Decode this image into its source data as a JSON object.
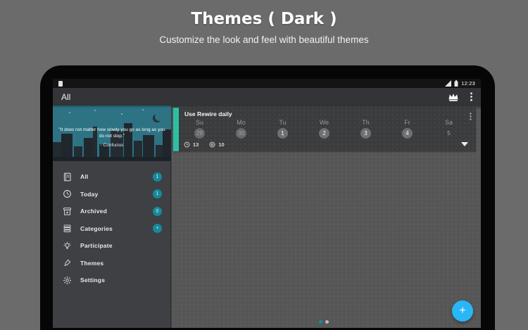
{
  "header": {
    "title": "Themes ( Dark )",
    "subtitle": "Customize the look and feel with beautiful themes"
  },
  "statusbar": {
    "time": "12:23"
  },
  "appbar": {
    "title": "All"
  },
  "drawer": {
    "quote_text": "\"It does not matter how slowly you go as long as you do not stop.\"",
    "quote_author": "- Confucius",
    "items": [
      {
        "label": "All",
        "badge": "1",
        "icon": "journal-icon"
      },
      {
        "label": "Today",
        "badge": "1",
        "icon": "today-icon"
      },
      {
        "label": "Archived",
        "badge": "0",
        "icon": "archive-icon"
      },
      {
        "label": "Categories",
        "badge": "+",
        "icon": "categories-icon"
      },
      {
        "label": "Participate",
        "badge": "",
        "icon": "lightbulb-icon"
      },
      {
        "label": "Themes",
        "badge": "",
        "icon": "paintbrush-icon"
      },
      {
        "label": "Settings",
        "badge": "",
        "icon": "gear-icon"
      }
    ]
  },
  "main": {
    "card": {
      "title": "Use Rewire daily",
      "days": [
        {
          "name": "Su",
          "date": "29",
          "circled": true,
          "current_month": false
        },
        {
          "name": "Mo",
          "date": "30",
          "circled": true,
          "current_month": false
        },
        {
          "name": "Tu",
          "date": "1",
          "circled": true,
          "current_month": true
        },
        {
          "name": "We",
          "date": "2",
          "circled": true,
          "current_month": true
        },
        {
          "name": "Th",
          "date": "3",
          "circled": true,
          "current_month": true
        },
        {
          "name": "Fr",
          "date": "4",
          "circled": true,
          "current_month": true
        },
        {
          "name": "Sa",
          "date": "5",
          "circled": false,
          "current_month": true
        }
      ],
      "stats": [
        {
          "icon": "clock-icon",
          "value": "13"
        },
        {
          "icon": "target-icon",
          "value": "10"
        }
      ]
    },
    "fab_label": "+",
    "pager": {
      "dot_count": 2,
      "active_index": 0
    }
  },
  "colors": {
    "page_background": "#6b6b6b",
    "drawer_header_teal": "#2d7383",
    "accent_teal": "#2bbfa4",
    "badge_teal": "#16899b",
    "fab_blue": "#29b6f6"
  }
}
